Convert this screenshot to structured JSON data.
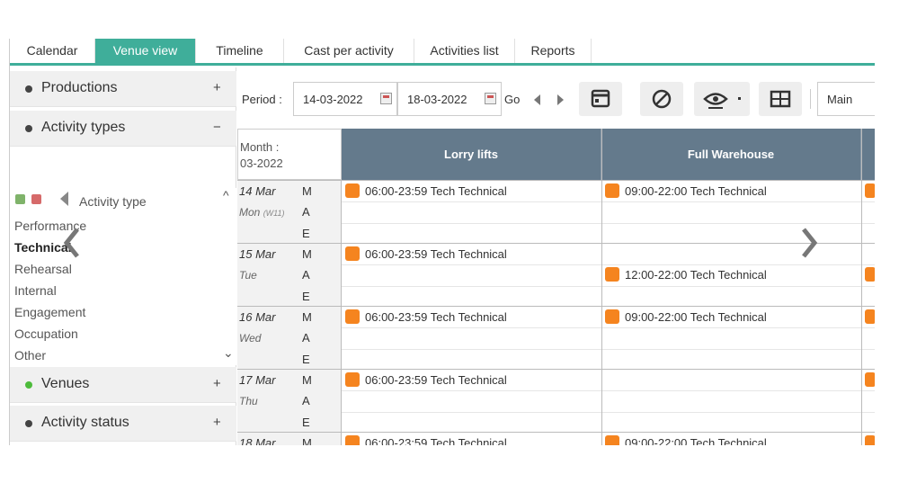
{
  "tabs": [
    {
      "label": "Calendar",
      "active": false
    },
    {
      "label": "Venue view",
      "active": true
    },
    {
      "label": "Timeline",
      "active": false
    },
    {
      "label": "Cast per activity",
      "active": false
    },
    {
      "label": "Activities list",
      "active": false
    },
    {
      "label": "Reports",
      "active": false
    }
  ],
  "sidebar": {
    "productions": {
      "label": "Productions",
      "toggle": "+"
    },
    "activity_types": {
      "label": "Activity types",
      "toggle": "−"
    },
    "activity_type_header": "Activity type",
    "activity_type_items": [
      "Performance",
      "Technical",
      "Rehearsal",
      "Internal",
      "Engagement",
      "Occupation",
      "Other"
    ],
    "venues": {
      "label": "Venues",
      "toggle": "+"
    },
    "activity_status": {
      "label": "Activity status",
      "toggle": "+"
    }
  },
  "toolbar": {
    "period_label": "Period :",
    "date_from": "14-03-2022",
    "date_to": "18-03-2022",
    "go_label": "Go",
    "view_value": "Main"
  },
  "grid": {
    "month_label": "Month :",
    "month_value": "03-2022",
    "venues": [
      "Lorry lifts",
      "Full Warehouse"
    ],
    "slots": [
      "M",
      "A",
      "E"
    ],
    "days": [
      {
        "date": "14 Mar",
        "weekday": "Mon",
        "week": "(W11)",
        "events": [
          {
            "venue": 0,
            "slot": 0,
            "text": "06:00-23:59  Tech Technical"
          },
          {
            "venue": 1,
            "slot": 0,
            "text": "09:00-22:00  Tech Technical"
          }
        ]
      },
      {
        "date": "15 Mar",
        "weekday": "Tue",
        "week": "",
        "events": [
          {
            "venue": 0,
            "slot": 0,
            "text": "06:00-23:59  Tech Technical"
          },
          {
            "venue": 1,
            "slot": 1,
            "text": "12:00-22:00  Tech Technical"
          }
        ]
      },
      {
        "date": "16 Mar",
        "weekday": "Wed",
        "week": "",
        "events": [
          {
            "venue": 0,
            "slot": 0,
            "text": "06:00-23:59  Tech Technical"
          },
          {
            "venue": 1,
            "slot": 0,
            "text": "09:00-22:00  Tech Technical"
          }
        ]
      },
      {
        "date": "17 Mar",
        "weekday": "Thu",
        "week": "",
        "events": [
          {
            "venue": 0,
            "slot": 0,
            "text": "06:00-23:59  Tech Technical"
          }
        ]
      },
      {
        "date": "18 Mar",
        "weekday": "",
        "week": "",
        "events": [
          {
            "venue": 0,
            "slot": 0,
            "text": "06:00-23:59  Tech Technical"
          },
          {
            "venue": 1,
            "slot": 0,
            "text": "09:00-22:00  Tech Technical"
          }
        ]
      }
    ]
  },
  "colors": {
    "accent": "#3fae9a",
    "header_bg": "#647a8c",
    "event": "#f5841f"
  }
}
